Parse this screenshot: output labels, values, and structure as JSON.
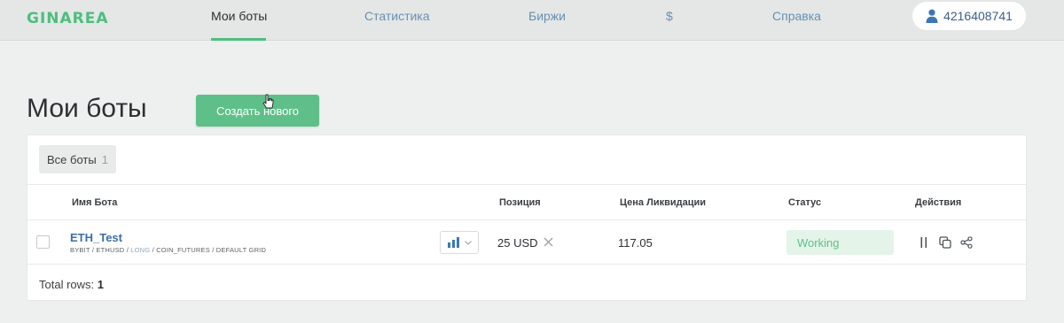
{
  "nav": {
    "logo": "GINAREA",
    "links": [
      {
        "label": "Мои боты",
        "active": true
      },
      {
        "label": "Статистика",
        "active": false
      },
      {
        "label": "Биржи",
        "active": false
      },
      {
        "label": "$",
        "active": false
      },
      {
        "label": "Справка",
        "active": false
      }
    ],
    "user_id": "4216408741",
    "user_icon": "user-icon"
  },
  "page": {
    "title": "Мои боты",
    "create_button": "Создать нового"
  },
  "filters": {
    "chip_label": "Все боты",
    "chip_count": "1"
  },
  "table": {
    "headers": {
      "name": "Имя Бота",
      "position": "Позиция",
      "liquidation": "Цена Ликвидации",
      "status": "Статус",
      "actions": "Действия"
    },
    "rows": [
      {
        "name": "ETH_Test",
        "meta_prefix": "BYBIT / ETHUSD / ",
        "meta_side": "LONG",
        "meta_suffix": " / COIN_FUTURES / DEFAULT GRID",
        "position": "25 USD",
        "liquidation_price": "117.05",
        "status": "Working"
      }
    ],
    "footer_label": "Total rows:",
    "footer_count": "1"
  },
  "colors": {
    "accent": "#4cbf7d",
    "button": "#5ec088",
    "link": "#3a6fa6",
    "status_bg": "#e4f4e9"
  }
}
